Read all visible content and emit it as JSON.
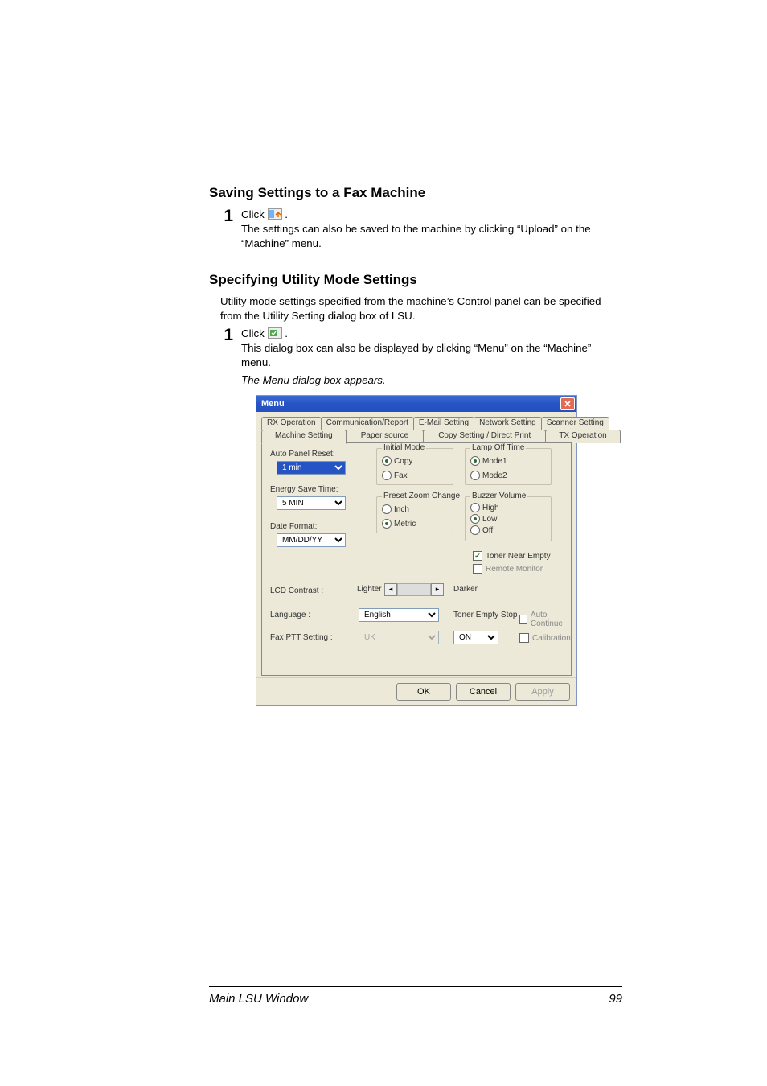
{
  "section1": {
    "title": "Saving Settings to a Fax Machine",
    "step1_prefix": "Click ",
    "step1_suffix": " .",
    "para1": "The settings can also be saved to the machine by clicking “Upload” on the “Machine” menu."
  },
  "section2": {
    "title": "Specifying Utility Mode Settings",
    "intro": "Utility mode settings specified from the machine’s Control panel can be specified from the Utility Setting dialog box of LSU.",
    "step1_prefix": "Click ",
    "step1_suffix": " .",
    "para1": "This dialog box can also be displayed by clicking “Menu” on the “Machine” menu.",
    "para2": "The Menu dialog box appears."
  },
  "dialog": {
    "title": "Menu",
    "tabs_row1": {
      "rx": "RX Operation",
      "comm": "Communication/Report",
      "email": "E-Mail Setting",
      "network": "Network Setting",
      "scanner": "Scanner Setting"
    },
    "tabs_row2": {
      "machine": "Machine Setting",
      "paper": "Paper source",
      "copy": "Copy Setting / Direct Print",
      "tx": "TX Operation"
    },
    "auto_panel_reset": {
      "label": "Auto Panel Reset:",
      "value": "1 min"
    },
    "energy_save": {
      "label": "Energy Save Time:",
      "value": "5 MIN"
    },
    "date_format": {
      "label": "Date Format:",
      "value": "MM/DD/YY"
    },
    "initial_mode": {
      "title": "Initial Mode",
      "copy": "Copy",
      "fax": "Fax"
    },
    "preset_zoom": {
      "title": "Preset Zoom Change",
      "inch": "Inch",
      "metric": "Metric"
    },
    "lamp_off": {
      "title": "Lamp Off Time",
      "mode1": "Mode1",
      "mode2": "Mode2"
    },
    "buzzer": {
      "title": "Buzzer Volume",
      "high": "High",
      "low": "Low",
      "off": "Off"
    },
    "toner_near_empty": "Toner Near Empty",
    "remote_monitor": "Remote Monitor",
    "lcd": {
      "label": "LCD Contrast :",
      "lighter": "Lighter",
      "darker": "Darker"
    },
    "language": {
      "label": "Language :",
      "value": "English"
    },
    "tes": {
      "label": "Toner Empty Stop",
      "auto": "Auto Continue"
    },
    "fax_ptt": {
      "label": "Fax PTT Setting :",
      "value": "UK",
      "on_value": "ON",
      "calibration": "Calibration"
    },
    "buttons": {
      "ok": "OK",
      "cancel": "Cancel",
      "apply": "Apply"
    }
  },
  "footer": {
    "left": "Main LSU Window",
    "page": "99"
  }
}
